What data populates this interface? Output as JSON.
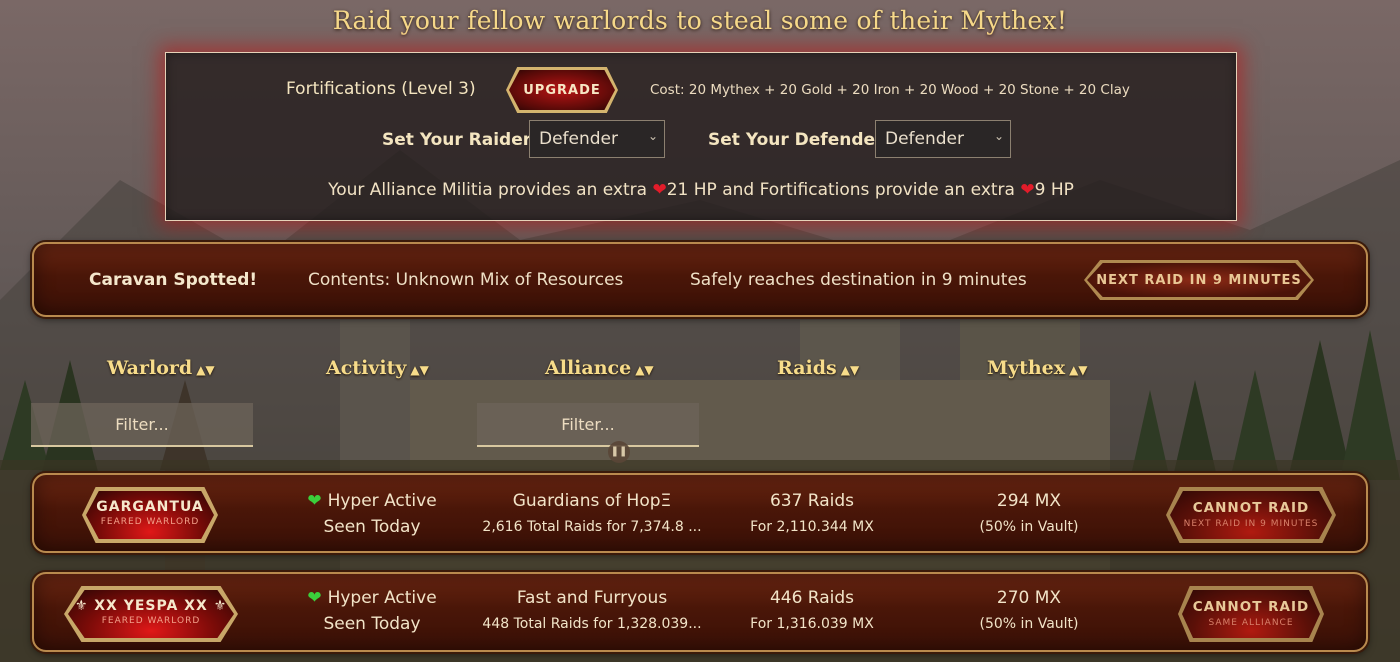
{
  "page": {
    "title": "Raid your fellow warlords to steal some of their Mythex!"
  },
  "fortifications": {
    "label": "Fortifications (Level 3)",
    "upgrade_label": "UPGRADE",
    "cost": "Cost: 20 Mythex + 20 Gold + 20 Iron + 20 Wood + 20 Stone + 20 Clay",
    "raiders_label": "Set Your Raiders:",
    "raiders_value": "Defender",
    "defenders_label": "Set Your Defenders:",
    "defenders_value": "Defender",
    "militia_text_1": "Your Alliance Militia provides an extra",
    "militia_hp": "21 HP",
    "militia_text_2": "and Fortifications provide an extra",
    "fort_hp": "9 HP"
  },
  "caravan": {
    "status": "Caravan Spotted!",
    "contents": "Contents: Unknown Mix of Resources",
    "eta": "Safely reaches destination in 9 minutes",
    "next_raid_label": "NEXT RAID IN 9 MINUTES"
  },
  "table": {
    "columns": [
      {
        "label": "Warlord",
        "sort": "▲▼"
      },
      {
        "label": "Activity",
        "sort": "▲▼"
      },
      {
        "label": "Alliance",
        "sort": "▲▼"
      },
      {
        "label": "Raids",
        "sort": "▲▼"
      },
      {
        "label": "Mythex",
        "sort": "▲▼"
      }
    ],
    "filters": {
      "warlord_placeholder": "Filter...",
      "alliance_placeholder": "Filter..."
    },
    "rows": [
      {
        "warlord": "GARGANTUA",
        "rank": "FEARED WARLORD",
        "activity": "Hyper Active",
        "seen": "Seen Today",
        "alliance": "Guardians of HopΞ",
        "alliance_stats": "2,616 Total Raids for 7,374.8 ...",
        "raids": "637 Raids",
        "raids_for": "For 2,110.344 MX",
        "mythex": "294 MX",
        "vault": "(50% in Vault)",
        "action": "CANNOT RAID",
        "action_reason": "NEXT RAID IN 9 MINUTES"
      },
      {
        "warlord": "⚜ XX YESPA XX ⚜",
        "rank": "FEARED WARLORD",
        "activity": "Hyper Active",
        "seen": "Seen Today",
        "alliance": "Fast and Furryous",
        "alliance_stats": "448 Total Raids for 1,328.039...",
        "raids": "446 Raids",
        "raids_for": "For 1,316.039 MX",
        "mythex": "270 MX",
        "vault": "(50% in Vault)",
        "action": "CANNOT RAID",
        "action_reason": "SAME ALLIANCE"
      }
    ]
  },
  "colors": {
    "accent_gold": "#f7dc8a",
    "button_red": "#b81414",
    "bar_brown": "#4a1608",
    "active_green": "#3bcf3b",
    "heart_red": "#e21c2a"
  }
}
